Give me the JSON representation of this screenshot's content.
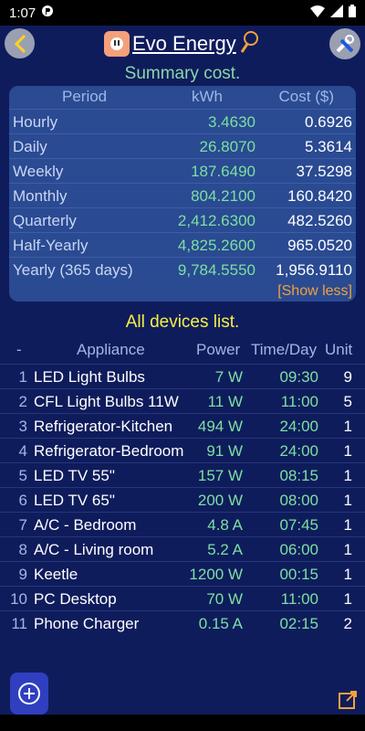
{
  "status": {
    "time": "1:07"
  },
  "header": {
    "title": "Evo Energy"
  },
  "summary": {
    "title": "Summary cost.",
    "headers": {
      "period": "Period",
      "kwh": "kWh",
      "cost": "Cost ($)"
    },
    "rows": [
      {
        "period": "Hourly",
        "kwh": "3.4630",
        "cost": "0.6926"
      },
      {
        "period": "Daily",
        "kwh": "26.8070",
        "cost": "5.3614"
      },
      {
        "period": "Weekly",
        "kwh": "187.6490",
        "cost": "37.5298"
      },
      {
        "period": "Monthly",
        "kwh": "804.2100",
        "cost": "160.8420"
      },
      {
        "period": "Quarterly",
        "kwh": "2,412.6300",
        "cost": "482.5260"
      },
      {
        "period": "Half-Yearly",
        "kwh": "4,825.2600",
        "cost": "965.0520"
      },
      {
        "period": "Yearly (365 days)",
        "kwh": "9,784.5550",
        "cost": "1,956.9110"
      }
    ],
    "show_less": "[Show less]"
  },
  "devices": {
    "title": "All devices list.",
    "headers": {
      "idx": "-",
      "name": "Appliance",
      "power": "Power",
      "time": "Time/Day",
      "unit": "Unit"
    },
    "rows": [
      {
        "idx": "1",
        "name": "LED Light Bulbs",
        "power": "7 W",
        "time": "09:30",
        "unit": "9"
      },
      {
        "idx": "2",
        "name": "CFL Light Bulbs 11W",
        "power": "11 W",
        "time": "11:00",
        "unit": "5"
      },
      {
        "idx": "3",
        "name": "Refrigerator-Kitchen",
        "power": "494 W",
        "time": "24:00",
        "unit": "1"
      },
      {
        "idx": "4",
        "name": "Refrigerator-Bedroom",
        "power": "91 W",
        "time": "24:00",
        "unit": "1"
      },
      {
        "idx": "5",
        "name": "LED TV 55\"",
        "power": "157 W",
        "time": "08:15",
        "unit": "1"
      },
      {
        "idx": "6",
        "name": "LED TV 65\"",
        "power": "200 W",
        "time": "08:00",
        "unit": "1"
      },
      {
        "idx": "7",
        "name": "A/C - Bedroom",
        "power": "4.8 A",
        "time": "07:45",
        "unit": "1"
      },
      {
        "idx": "8",
        "name": "A/C - Living room",
        "power": "5.2 A",
        "time": "06:00",
        "unit": "1"
      },
      {
        "idx": "9",
        "name": "Keetle",
        "power": "1200 W",
        "time": "00:15",
        "unit": "1"
      },
      {
        "idx": "10",
        "name": "PC Desktop",
        "power": "70 W",
        "time": "11:00",
        "unit": "1"
      },
      {
        "idx": "11",
        "name": "Phone Charger",
        "power": "0.15 A",
        "time": "02:15",
        "unit": "2"
      }
    ]
  }
}
